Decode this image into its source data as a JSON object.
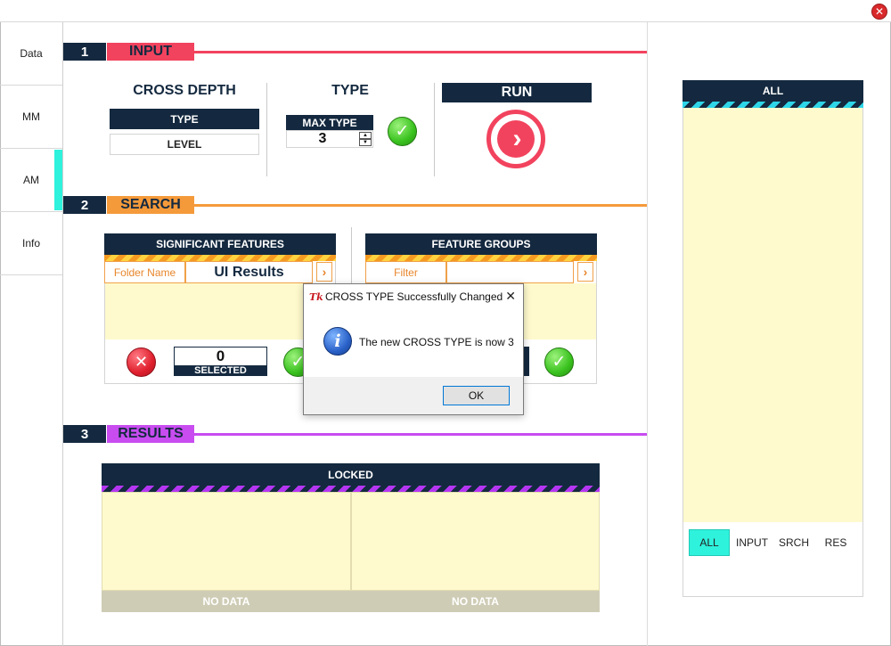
{
  "window": {
    "close_label": "✕"
  },
  "sidebar": {
    "items": [
      {
        "label": "Data"
      },
      {
        "label": "MM"
      },
      {
        "label": "AM"
      },
      {
        "label": "Info"
      }
    ],
    "active": "AM"
  },
  "sections": [
    {
      "number": "1",
      "label": "INPUT",
      "color": "#f2435e"
    },
    {
      "number": "2",
      "label": "SEARCH",
      "color": "#f59a3a"
    },
    {
      "number": "3",
      "label": "RESULTS",
      "color": "#c84cf0"
    }
  ],
  "input": {
    "cross_depth": {
      "heading": "CROSS DEPTH",
      "type_label": "TYPE",
      "level_label": "LEVEL"
    },
    "type": {
      "heading": "TYPE",
      "max_type_label": "MAX TYPE",
      "value": "3"
    },
    "run": {
      "label": "RUN"
    }
  },
  "search": {
    "significant_features": {
      "title": "SIGNIFICANT FEATURES",
      "folder_label": "Folder Name",
      "folder_value": "UI Results",
      "selected_count": "0",
      "selected_label": "SELECTED"
    },
    "feature_groups": {
      "title": "FEATURE GROUPS",
      "filter_label": "Filter",
      "filter_value": ""
    }
  },
  "results": {
    "title": "LOCKED",
    "left_status": "NO DATA",
    "right_status": "NO DATA"
  },
  "right_panel": {
    "title": "ALL",
    "tabs": [
      "ALL",
      "INPUT",
      "SRCH",
      "RES"
    ],
    "active_tab": "ALL"
  },
  "dialog": {
    "app_icon": "Tk",
    "title": "CROSS TYPE Successfully Changed",
    "message": "The new CROSS TYPE is now 3",
    "ok_label": "OK",
    "close_label": "✕",
    "info_glyph": "i"
  },
  "colors": {
    "navy": "#14293f",
    "input_accent": "#f2435e",
    "search_accent": "#f59a3a",
    "results_accent": "#c84cf0",
    "active_teal": "#2ef2dc",
    "cream": "#fffacd"
  }
}
